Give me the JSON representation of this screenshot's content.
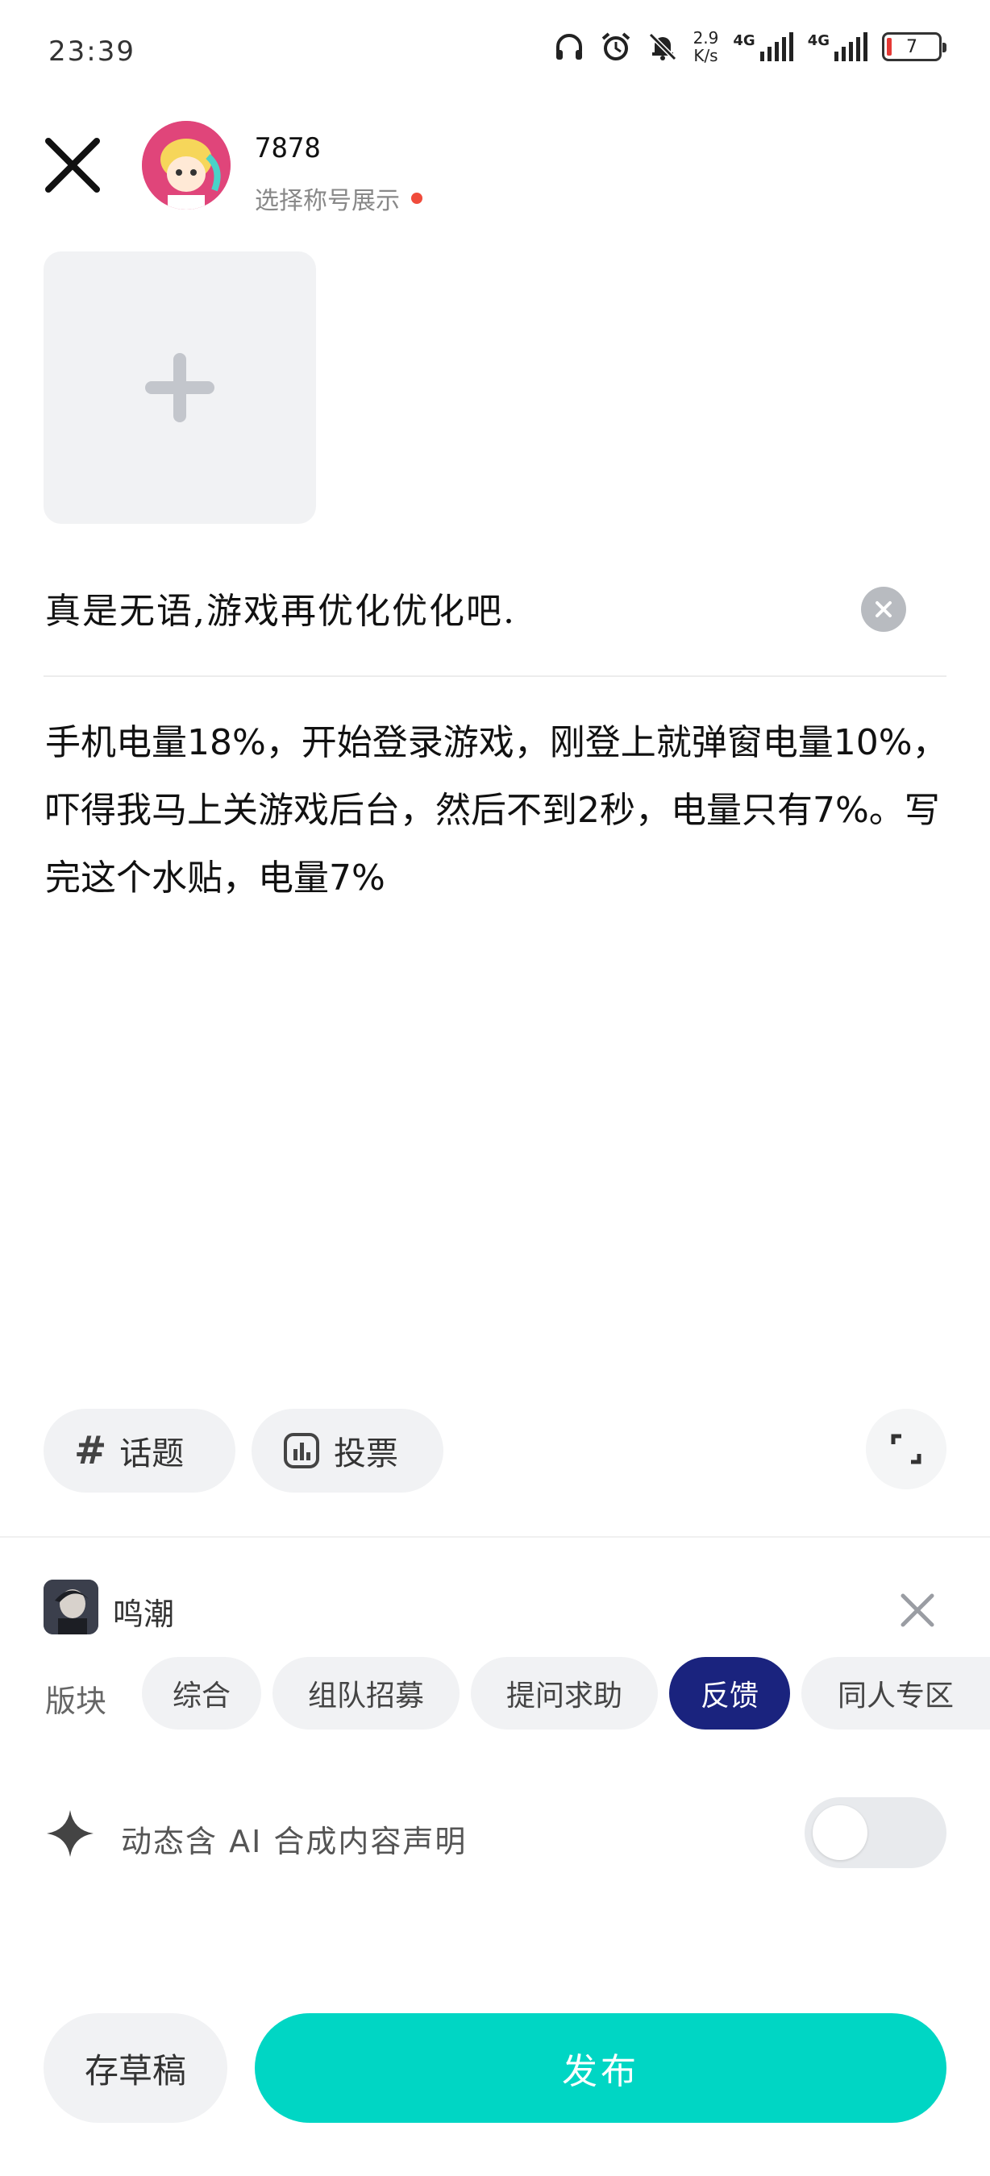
{
  "status_bar": {
    "time": "23:39",
    "net_speed_value": "2.9",
    "net_speed_unit": "K/s",
    "signal1_label": "4G",
    "signal2_label": "4G",
    "battery_level": "7",
    "battery_color": "#e53935"
  },
  "header": {
    "close_icon": "close-icon",
    "username": "7878",
    "subtitle": "选择称号展示"
  },
  "editor": {
    "add_image_icon": "plus-icon",
    "title": "真是无语,游戏再优化优化吧.",
    "body": "手机电量18%，开始登录游戏，刚登上就弹窗电量10%，吓得我马上关游戏后台，然后不到2秒，电量只有7%。写完这个水贴，电量7%"
  },
  "tools": {
    "topic_label": "话题",
    "vote_label": "投票"
  },
  "game": {
    "name": "鸣潮"
  },
  "sections": {
    "label": "版块",
    "items": [
      {
        "label": "综合",
        "selected": false
      },
      {
        "label": "组队招募",
        "selected": false
      },
      {
        "label": "提问求助",
        "selected": false
      },
      {
        "label": "反馈",
        "selected": true
      },
      {
        "label": "同人专区",
        "selected": false
      }
    ]
  },
  "ai_declaration": {
    "label": "动态含 AI 合成内容声明",
    "enabled": false
  },
  "actions": {
    "draft_label": "存草稿",
    "publish_label": "发布",
    "accent_color": "#00d6c4"
  }
}
